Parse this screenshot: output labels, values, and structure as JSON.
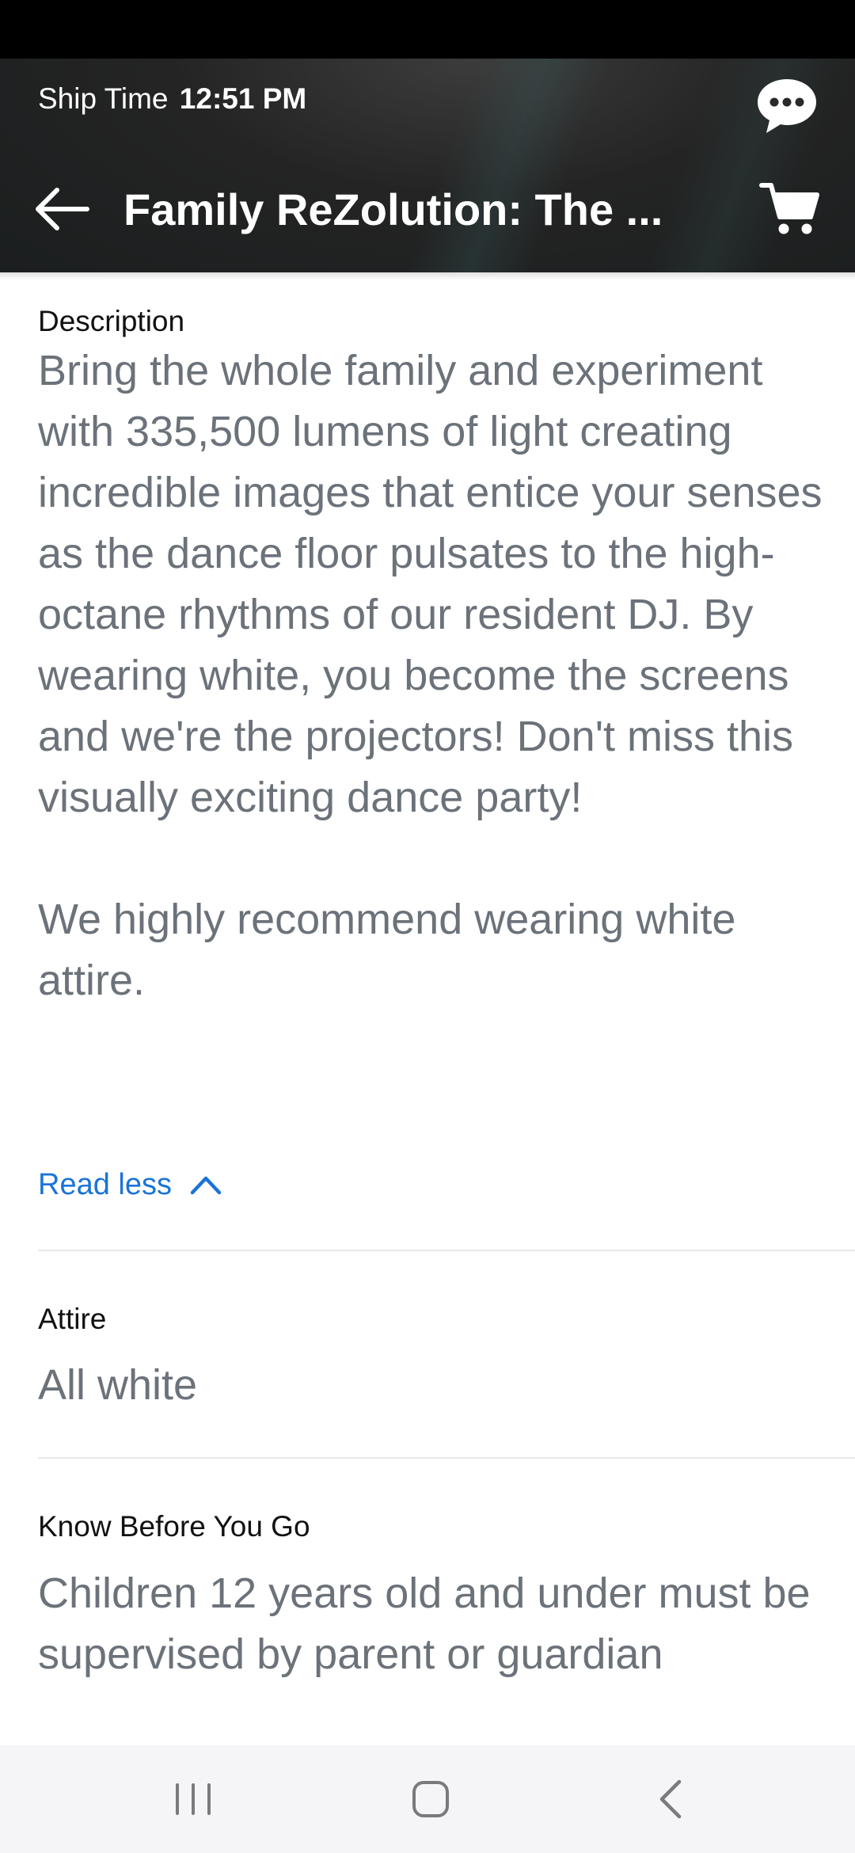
{
  "header": {
    "ship_time_label": "Ship Time",
    "ship_time_value": "12:51 PM",
    "title": "Family ReZolution: The ...",
    "icons": [
      "chat-bubble-icon",
      "back-arrow-icon",
      "cart-icon"
    ]
  },
  "description": {
    "label": "Description",
    "paragraph_1": "Bring the whole family and experiment with 335,500 lumens of light creating incredible images that entice your senses as the dance floor pulsates to the high-octane rhythms of our resident DJ. By wearing white, you become the screens and we're the projectors! Don't miss this visually exciting dance party!",
    "paragraph_2": "We highly recommend wearing white attire.",
    "toggle_label": "Read less"
  },
  "attire": {
    "label": "Attire",
    "value": "All white"
  },
  "know_before": {
    "label": "Know Before You Go",
    "value": "Children 12 years old and under must be supervised by parent or guardian"
  },
  "colors": {
    "header_bg": "#242424",
    "link": "#1a73d9",
    "body_text": "#6c727a",
    "label_text": "#111111",
    "divider": "#e8e8e8",
    "nav_bg": "#f5f5f7"
  },
  "system_nav": {
    "icons": [
      "recent-apps-icon",
      "home-icon",
      "back-icon"
    ]
  }
}
